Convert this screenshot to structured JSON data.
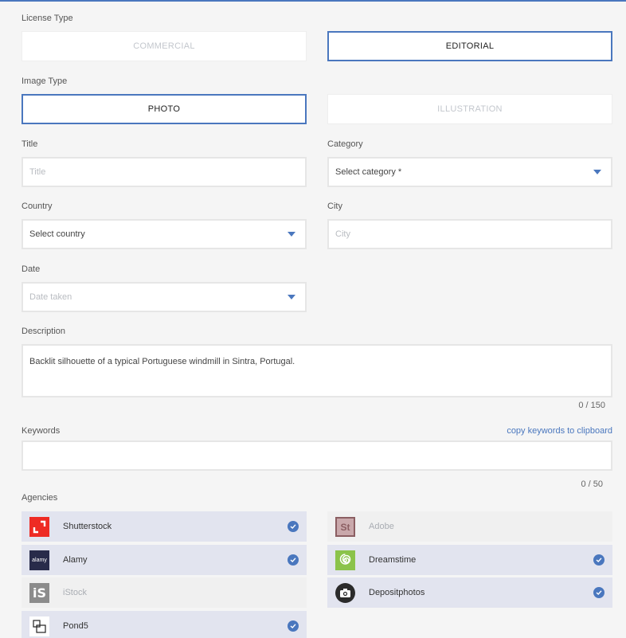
{
  "license": {
    "label": "License Type",
    "options": [
      "COMMERCIAL",
      "EDITORIAL"
    ],
    "selected": "EDITORIAL"
  },
  "image_type": {
    "label": "Image Type",
    "options": [
      "PHOTO",
      "ILLUSTRATION"
    ],
    "selected": "PHOTO"
  },
  "title": {
    "label": "Title",
    "placeholder": "Title",
    "value": ""
  },
  "category": {
    "label": "Category",
    "value": "Select category *"
  },
  "country": {
    "label": "Country",
    "value": "Select country"
  },
  "city": {
    "label": "City",
    "placeholder": "City",
    "value": ""
  },
  "date": {
    "label": "Date",
    "value": "Date taken"
  },
  "description": {
    "label": "Description",
    "value": "Backlit silhouette of a typical Portuguese windmill in Sintra, Portugal.",
    "counter": "0 / 150"
  },
  "keywords": {
    "label": "Keywords",
    "copy_link": "copy keywords to clipboard",
    "value": "",
    "counter": "0 / 50"
  },
  "agencies": {
    "label": "Agencies",
    "items": [
      {
        "name": "Shutterstock",
        "enabled": true,
        "checked": true,
        "icon": "shutterstock-logo",
        "color": "#ee2b24"
      },
      {
        "name": "Adobe",
        "enabled": false,
        "checked": false,
        "icon": "adobe-stock-logo",
        "color": "#8b5e62"
      },
      {
        "name": "Alamy",
        "enabled": true,
        "checked": true,
        "icon": "alamy-logo",
        "logo_text": "alamy",
        "color": "#282b4a"
      },
      {
        "name": "Dreamstime",
        "enabled": true,
        "checked": true,
        "icon": "dreamstime-logo",
        "color": "#8bc34a"
      },
      {
        "name": "iStock",
        "enabled": false,
        "checked": false,
        "icon": "istock-logo",
        "logo_text": "iS",
        "color": "#8c8c8c"
      },
      {
        "name": "Depositphotos",
        "enabled": true,
        "checked": true,
        "icon": "depositphotos-logo",
        "color": "#2b2b2b"
      },
      {
        "name": "Pond5",
        "enabled": true,
        "checked": true,
        "icon": "pond5-logo",
        "color": "#222222"
      }
    ]
  },
  "colors": {
    "accent": "#4a77be",
    "agency_bg": "#e2e4ef"
  }
}
